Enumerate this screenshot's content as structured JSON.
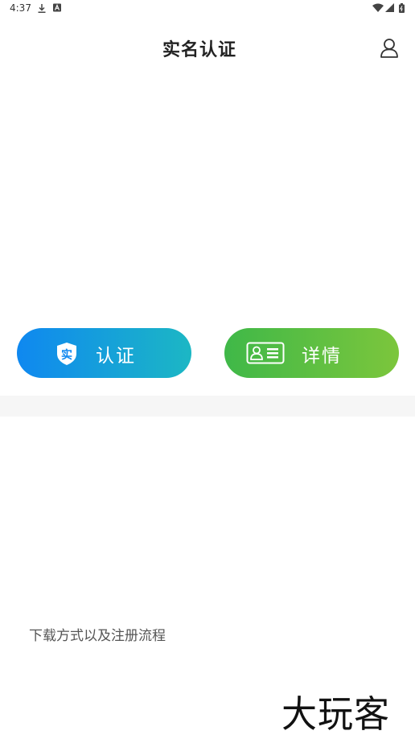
{
  "status_bar": {
    "time": "4:37",
    "left_icons": [
      "download-icon",
      "notification-a-icon"
    ],
    "right_icons": [
      "wifi-icon",
      "signal-icon",
      "battery-icon"
    ]
  },
  "header": {
    "title": "实名认证",
    "user_icon": "user-icon"
  },
  "actions": {
    "verify": {
      "label": "认证",
      "badge_char": "实",
      "gradient": [
        "#0f88f0",
        "#1cb7c4"
      ]
    },
    "details": {
      "label": "详情",
      "icon": "id-card-icon",
      "gradient": [
        "#3fb848",
        "#7cc63c"
      ]
    }
  },
  "guide_link": "下载方式以及注册流程",
  "watermark": "大玩客"
}
